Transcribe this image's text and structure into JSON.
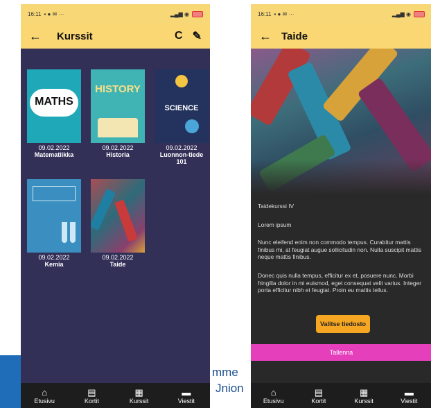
{
  "left_phone": {
    "status": {
      "time": "16:11",
      "extra": "▪ ● ✉ ···",
      "icons": "▂▄▆ ◉"
    },
    "appbar": {
      "back": "←",
      "title": "Kurssit",
      "refresh": "C",
      "edit": "✎"
    },
    "courses": [
      {
        "thumb_word": "MATHS",
        "date": "09.02.2022",
        "name": "Matematiikka"
      },
      {
        "thumb_word": "HISTORY",
        "date": "09.02.2022",
        "name": "Historia"
      },
      {
        "thumb_word": "SCIENCE",
        "date": "09.02.2022",
        "name": "Luonnon-tiede 101"
      },
      {
        "thumb_word": "",
        "date": "09.02.2022",
        "name": "Kemia"
      },
      {
        "thumb_word": "",
        "date": "09.02.2022",
        "name": "Taide"
      }
    ]
  },
  "right_phone": {
    "status": {
      "time": "16:11",
      "extra": "▪ ● ✉ ···",
      "icons": "▂▄▆ ◉"
    },
    "appbar": {
      "back": "←",
      "title": "Taide"
    },
    "course_name": "Taidekurssi IV",
    "subtitle": "Lorem ipsum",
    "paragraph1": "Nunc eleifend enim non commodo tempus. Curabitur mattis finibus mi, at feugiat augue sollicitudin non. Nulla suscipit mattis neque mattis finibus.",
    "paragraph2": "Donec quis nulla tempus, efficitur ex et, posuere nunc. Morbi fringilla dolor in mi euismod, eget consequat velit varius. Integer porta efficitur nibh et feugiat. Proin eu mattis tellus.",
    "file_button": "Valitse tiedosto",
    "save_button": "Tallenna"
  },
  "bottom_nav": [
    {
      "icon": "home-icon",
      "glyph": "⌂",
      "label": "Etusivu"
    },
    {
      "icon": "calendar-icon",
      "glyph": "▤",
      "label": "Kortit"
    },
    {
      "icon": "library-icon",
      "glyph": "▦",
      "label": "Kurssit"
    },
    {
      "icon": "chat-icon",
      "glyph": "▬",
      "label": "Viestit"
    }
  ],
  "background": {
    "fragment1": "mme",
    "fragment2": "Jnion"
  },
  "colors": {
    "header": "#fbd774",
    "left_bg": "#333058",
    "right_bg": "#292929",
    "file_button": "#f5a623",
    "save_button": "#e53fbb"
  }
}
